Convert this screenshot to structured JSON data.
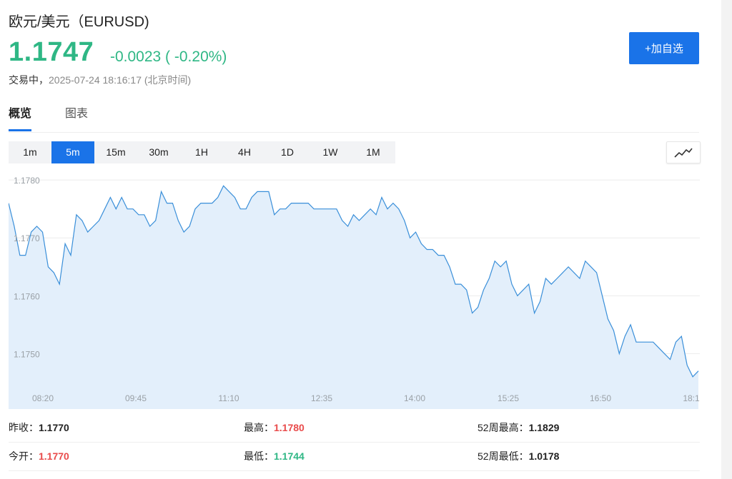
{
  "header": {
    "title": "欧元/美元（EURUSD)",
    "price": "1.1747",
    "change": "-0.0023 ( -0.20%)",
    "status_label": "交易中，",
    "status_time": "2025-07-24 18:16:17 (北京时间)",
    "add_button": "+加自选"
  },
  "tabs": [
    {
      "label": "概览",
      "active": true
    },
    {
      "label": "图表",
      "active": false
    }
  ],
  "periods": [
    "1m",
    "5m",
    "15m",
    "30m",
    "1H",
    "4H",
    "1D",
    "1W",
    "1M"
  ],
  "active_period": "5m",
  "chart_type_icon": "line-chart-icon",
  "colors": {
    "accent": "#1a73e8",
    "down": "#2fb785",
    "up": "#e94b4b",
    "line": "#3a8fd9",
    "fill": "#e3effb"
  },
  "stats": [
    [
      {
        "label": "昨收：",
        "value": "1.1770",
        "tone": "neutral"
      },
      {
        "label": "最高：",
        "value": "1.1780",
        "tone": "up"
      },
      {
        "label": "52周最高：",
        "value": "1.1829",
        "tone": "neutral"
      }
    ],
    [
      {
        "label": "今开：",
        "value": "1.1770",
        "tone": "up"
      },
      {
        "label": "最低：",
        "value": "1.1744",
        "tone": "down"
      },
      {
        "label": "52周最低：",
        "value": "1.0178",
        "tone": "neutral"
      }
    ]
  ],
  "chart_data": {
    "type": "area",
    "y_ticks": [
      "1.1780",
      "1.1770",
      "1.1760",
      "1.1750"
    ],
    "y_tick_values": [
      1.178,
      1.177,
      1.176,
      1.175
    ],
    "x_ticks": [
      "08:20",
      "09:45",
      "11:10",
      "12:35",
      "14:00",
      "15:25",
      "16:50",
      "18:1"
    ],
    "ylim": [
      1.17445,
      1.17815
    ],
    "values": [
      1.1776,
      1.1772,
      1.1767,
      1.1767,
      1.1771,
      1.1772,
      1.1771,
      1.1765,
      1.1764,
      1.1762,
      1.1769,
      1.1767,
      1.1774,
      1.1773,
      1.1771,
      1.1772,
      1.1773,
      1.1775,
      1.1777,
      1.1775,
      1.1777,
      1.1775,
      1.1775,
      1.1774,
      1.1774,
      1.1772,
      1.1773,
      1.1778,
      1.1776,
      1.1776,
      1.1773,
      1.1771,
      1.1772,
      1.1775,
      1.1776,
      1.1776,
      1.1776,
      1.1777,
      1.1779,
      1.1778,
      1.1777,
      1.1775,
      1.1775,
      1.1777,
      1.1778,
      1.1778,
      1.1778,
      1.1774,
      1.1775,
      1.1775,
      1.1776,
      1.1776,
      1.1776,
      1.1776,
      1.1775,
      1.1775,
      1.1775,
      1.1775,
      1.1775,
      1.1773,
      1.1772,
      1.1774,
      1.1773,
      1.1774,
      1.1775,
      1.1774,
      1.1777,
      1.1775,
      1.1776,
      1.1775,
      1.1773,
      1.177,
      1.1771,
      1.1769,
      1.1768,
      1.1768,
      1.1767,
      1.1767,
      1.1765,
      1.1762,
      1.1762,
      1.1761,
      1.1757,
      1.1758,
      1.1761,
      1.1763,
      1.1766,
      1.1765,
      1.1766,
      1.1762,
      1.176,
      1.1761,
      1.1762,
      1.1757,
      1.1759,
      1.1763,
      1.1762,
      1.1763,
      1.1764,
      1.1765,
      1.1764,
      1.1763,
      1.1766,
      1.1765,
      1.1764,
      1.176,
      1.1756,
      1.1754,
      1.175,
      1.1753,
      1.1755,
      1.1752,
      1.1752,
      1.1752,
      1.1752,
      1.1751,
      1.175,
      1.1749,
      1.1752,
      1.1753,
      1.1748,
      1.1746,
      1.1747
    ]
  }
}
